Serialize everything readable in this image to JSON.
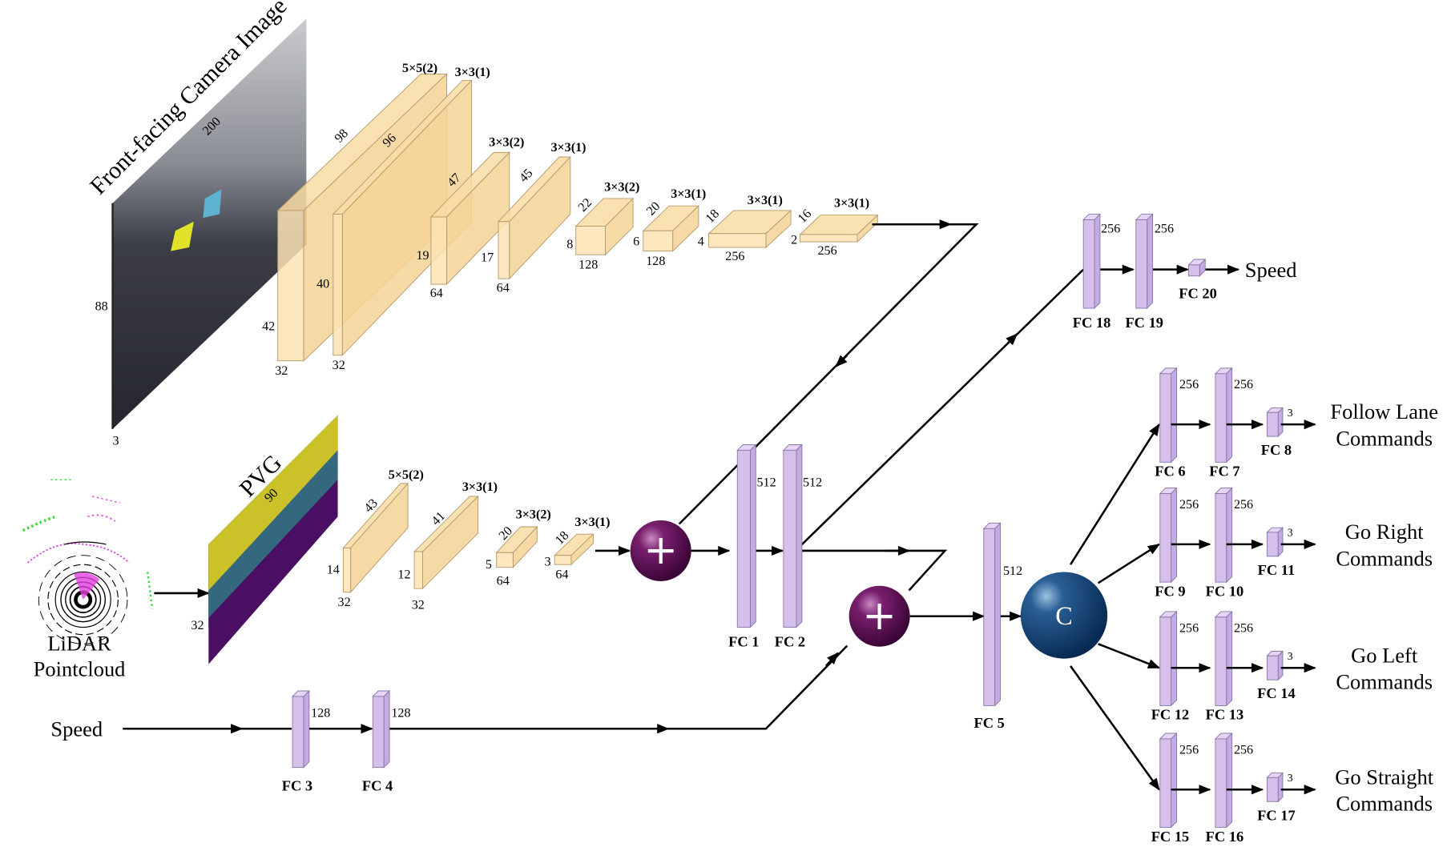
{
  "figure": {
    "camera_input": {
      "title": "Front-facing Camera Image",
      "width": "200",
      "height": "88",
      "channels": "3"
    },
    "lidar_input": {
      "title_line1": "LiDAR",
      "title_line2": "Pointcloud",
      "pvg_title": "PVG",
      "pvg_width": "90",
      "pvg_height": "32"
    },
    "speed_input": {
      "label": "Speed"
    },
    "camera_convs": [
      {
        "kernel": "5×5(2)",
        "width": "98",
        "height": "42",
        "channels": "32"
      },
      {
        "kernel": "3×3(1)",
        "width": "96",
        "height": "40",
        "channels": "32"
      },
      {
        "kernel": "3×3(2)",
        "width": "47",
        "height": "19",
        "channels": "64"
      },
      {
        "kernel": "3×3(1)",
        "width": "45",
        "height": "17",
        "channels": "64"
      },
      {
        "kernel": "3×3(2)",
        "width": "22",
        "height": "8",
        "channels": "128"
      },
      {
        "kernel": "3×3(1)",
        "width": "20",
        "height": "6",
        "channels": "128"
      },
      {
        "kernel": "3×3(1)",
        "width": "18",
        "height": "4",
        "channels": "256"
      },
      {
        "kernel": "3×3(1)",
        "width": "16",
        "height": "2",
        "channels": "256"
      }
    ],
    "lidar_convs": [
      {
        "kernel": "5×5(2)",
        "width": "43",
        "height": "14",
        "channels": "32"
      },
      {
        "kernel": "3×3(1)",
        "width": "41",
        "height": "12",
        "channels": "32"
      },
      {
        "kernel": "3×3(2)",
        "width": "20",
        "height": "5",
        "channels": "64"
      },
      {
        "kernel": "3×3(1)",
        "width": "18",
        "height": "3",
        "channels": "64"
      }
    ],
    "fc_layers": {
      "fc1": {
        "label": "FC 1",
        "units": "512"
      },
      "fc2": {
        "label": "FC 2",
        "units": "512"
      },
      "fc3": {
        "label": "FC 3",
        "units": "128"
      },
      "fc4": {
        "label": "FC 4",
        "units": "128"
      },
      "fc5": {
        "label": "FC 5",
        "units": "512"
      },
      "fc18": {
        "label": "FC 18",
        "units": "256"
      },
      "fc19": {
        "label": "FC 19",
        "units": "256"
      },
      "fc20": {
        "label": "FC 20"
      }
    },
    "operators": {
      "add_symbol": "+",
      "concat_symbol": "C"
    },
    "speed_output": {
      "label": "Speed"
    },
    "branches": [
      {
        "fc_a": "FC 6",
        "fc_b": "FC 7",
        "fc_c": "FC 8",
        "units_a": "256",
        "units_b": "256",
        "units_c": "3",
        "line1": "Follow Lane",
        "line2": "Commands"
      },
      {
        "fc_a": "FC 9",
        "fc_b": "FC 10",
        "fc_c": "FC 11",
        "units_a": "256",
        "units_b": "256",
        "units_c": "3",
        "line1": "Go Right",
        "line2": "Commands"
      },
      {
        "fc_a": "FC 12",
        "fc_b": "FC 13",
        "fc_c": "FC 14",
        "units_a": "256",
        "units_b": "256",
        "units_c": "3",
        "line1": "Go Left",
        "line2": "Commands"
      },
      {
        "fc_a": "FC 15",
        "fc_b": "FC 16",
        "fc_c": "FC 17",
        "units_a": "256",
        "units_b": "256",
        "units_c": "3",
        "line1": "Go Straight",
        "line2": "Commands"
      }
    ],
    "colors": {
      "conv_block": "#fbe3b3",
      "fc_block": "#d5c0ec",
      "add_node": "#5a0f52",
      "concat_node": "#0f3f70"
    }
  }
}
